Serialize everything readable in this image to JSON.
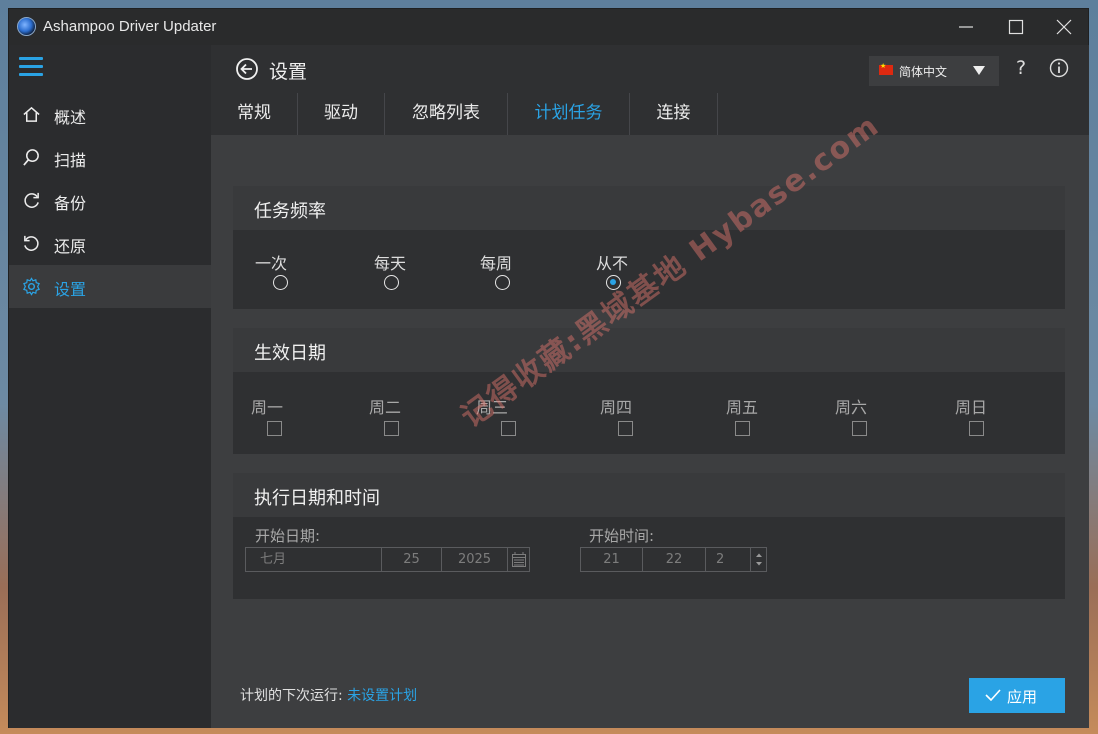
{
  "window": {
    "title": "Ashampoo Driver Updater"
  },
  "sidebar": {
    "items": [
      {
        "label": "概述",
        "icon": "home-icon"
      },
      {
        "label": "扫描",
        "icon": "search-icon"
      },
      {
        "label": "备份",
        "icon": "backup-icon"
      },
      {
        "label": "还原",
        "icon": "restore-icon"
      },
      {
        "label": "设置",
        "icon": "gear-icon",
        "active": true
      }
    ]
  },
  "header": {
    "title": "设置",
    "language": "简体中文",
    "help": "?"
  },
  "tabs": [
    {
      "label": "常规"
    },
    {
      "label": "驱动"
    },
    {
      "label": "忽略列表"
    },
    {
      "label": "计划任务",
      "active": true
    },
    {
      "label": "连接"
    }
  ],
  "frequency": {
    "title": "任务频率",
    "options": [
      "一次",
      "每天",
      "每周",
      "从不"
    ],
    "selected": "从不"
  },
  "effective": {
    "title": "生效日期",
    "days": [
      "周一",
      "周二",
      "周三",
      "周四",
      "周五",
      "周六",
      "周日"
    ]
  },
  "execution": {
    "title": "执行日期和时间",
    "start_date_label": "开始日期:",
    "start_date": {
      "month": "七月",
      "day": "25",
      "year": "2025"
    },
    "start_time_label": "开始时间:",
    "start_time": {
      "hour": "21",
      "minute": "22",
      "second": "2"
    }
  },
  "footer": {
    "next_run_label": "计划的下次运行: ",
    "next_run_value": "未设置计划",
    "apply_label": "应用"
  },
  "watermark": "记得收藏:黑域基地 Hybase.com",
  "colors": {
    "accent": "#2aa3e5",
    "panel": "#2f3032",
    "background": "#3d3e40"
  }
}
